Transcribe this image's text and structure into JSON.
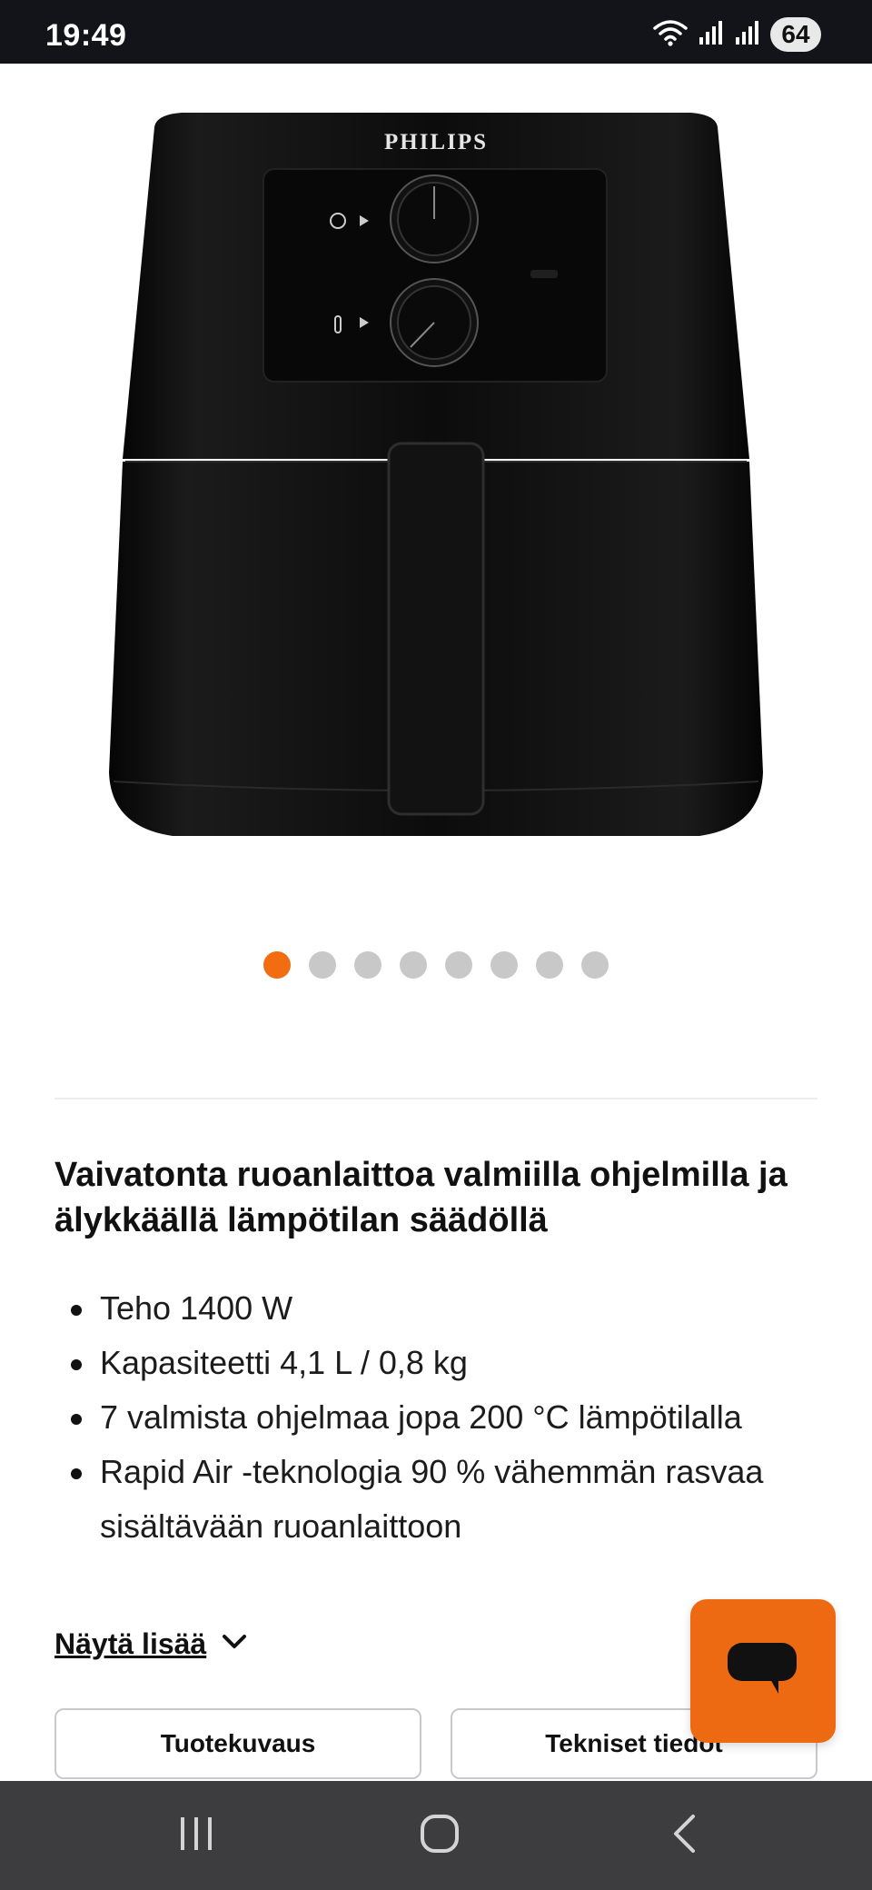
{
  "status_bar": {
    "time": "19:49",
    "battery": "64",
    "icons": [
      "wifi-icon",
      "signal-icon",
      "signal-icon",
      "battery-icon"
    ]
  },
  "product": {
    "brand_logo": "PHILIPS",
    "image_alt": "Philips Airfryer",
    "carousel": {
      "total": 8,
      "active_index": 0,
      "active_color": "#f26c12",
      "inactive_color": "#c8c8c8"
    }
  },
  "details": {
    "headline": "Vaivatonta ruoanlaittoa valmiilla ohjelmilla ja älykkäällä lämpötilan säädöllä",
    "features": [
      "Teho 1400 W",
      "Kapasiteetti 4,1 L / 0,8 kg",
      "7 valmista ohjelmaa jopa 200 °C lämpötilalla",
      "Rapid Air -teknologia 90 % vähemmän rasvaa sisältävään ruoanlaittoon"
    ],
    "show_more": "Näytä lisää"
  },
  "tabs": {
    "description": "Tuotekuvaus",
    "specs": "Tekniset tiedot"
  },
  "chat": {
    "icon": "chat-bubble-icon",
    "color": "#ee6a12"
  },
  "nav": {
    "icons": [
      "recent-apps-icon",
      "home-icon",
      "back-icon"
    ]
  }
}
